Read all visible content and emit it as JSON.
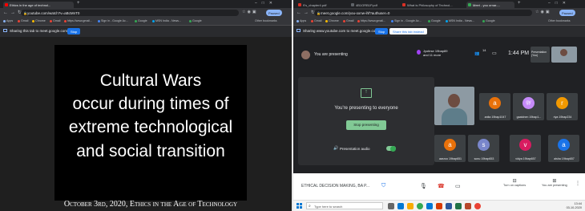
{
  "left": {
    "tabs": [
      {
        "label": "Ethics in the age of technol...",
        "active": true
      }
    ],
    "omnibox": "youtube.com/watch?v=aBcMnT0",
    "paused_label": "Paused",
    "bookmarks": [
      "Apps",
      "Gmail",
      "Chrome",
      "Gmail",
      "https://www.gmail...",
      "Sign in - Google Ac...",
      "Google",
      "MSN India - News...",
      "Google"
    ],
    "other_bookmarks": "Other bookmarks",
    "share_bar": {
      "text": "Sharing this tab to meet.google.com",
      "stop_label": "Stop"
    },
    "slide": {
      "lines": [
        "Cultural Wars",
        "occur during times of",
        "extreme technological",
        "and social transition"
      ],
      "caption": "October 3rd, 2020, Ethics in the Age of Technology"
    }
  },
  "right": {
    "tabs": [
      {
        "label": "9's_chapter4.pdf",
        "active": false
      },
      {
        "label": "4B1ORB1P.pdf",
        "active": false
      },
      {
        "label": "What is Philosophy of Technol...",
        "active": false
      },
      {
        "label": "Meet - you ornar-...",
        "active": true
      }
    ],
    "omnibox": "meet.google.com/you-oxnw-ihf?authuser=0",
    "paused_label": "Paused",
    "bookmarks": [
      "Apps",
      "Gmail",
      "Chrome",
      "Gmail",
      "https://www.gmail...",
      "Sign in - Google Ac...",
      "Google",
      "MSN India - News...",
      "Google"
    ],
    "other_bookmarks": "Other bookmarks",
    "share_bar": {
      "text": "Sharing www.youtube.com to meet.google.com",
      "stop_label": "Stop",
      "switch_label": "Share this tab instead"
    },
    "meet": {
      "presenting_label": "You are presenting",
      "joined_line1": "Jyotirse 19bap89",
      "joined_line2": "and 11 more",
      "participant_count": "14",
      "clock": "1:44 PM",
      "mini_tile_label": "Presentation (You)",
      "presentation_text": "You're presenting to everyone",
      "stop_presenting": "Stop presenting",
      "presentation_audio": "Presentation audio",
      "participants": [
        {
          "initial": "a",
          "name": "anita 19bap1047",
          "color": "#e8710a"
        },
        {
          "initial": "gy",
          "name": "gaatchen 19bap1...",
          "color": "#c58af9"
        },
        {
          "initial": "r",
          "name": "riya 19bap234",
          "color": "#f29900"
        },
        {
          "initial": "a",
          "name": "aarzoo 19bap651",
          "color": "#e8710a"
        },
        {
          "initial": "s",
          "name": "sonu 19bap653",
          "color": "#7986cb"
        },
        {
          "initial": "v",
          "name": "vidya 19bap657",
          "color": "#d81b60"
        },
        {
          "initial": "a",
          "name": "aisha 19bap657",
          "color": "#1a73e8"
        }
      ],
      "meeting_title": "ETHICAL DECISION MAKING, BA P...",
      "captions_label": "Turn on captions",
      "present_label": "You are presenting"
    },
    "taskbar": {
      "search_placeholder": "Type here to search",
      "tray_time": "13:44",
      "tray_date": "03-10-2020"
    }
  }
}
